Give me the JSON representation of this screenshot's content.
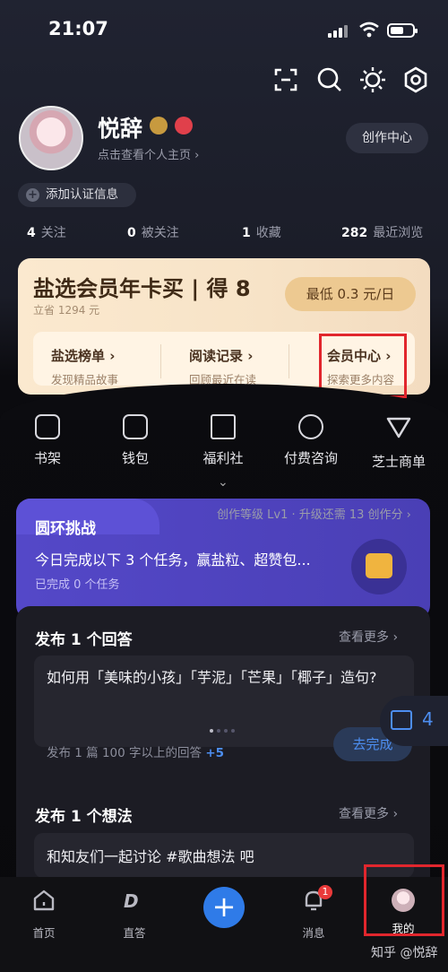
{
  "status": {
    "time": "21:07"
  },
  "profile": {
    "name": "悦辞",
    "subtitle": "点击查看个人主页 ›",
    "creator_button": "创作中心",
    "auth_button": "添加认证信息"
  },
  "stats": [
    {
      "value": "4",
      "label": "关注"
    },
    {
      "value": "0",
      "label": "被关注"
    },
    {
      "value": "1",
      "label": "收藏"
    },
    {
      "value": "282",
      "label": "最近浏览"
    }
  ],
  "vip": {
    "title": "盐选会员年卡买 | 得 8",
    "subtitle": "立省 1294 元",
    "price_button": "最低 0.3 元/日",
    "items": [
      {
        "title": "盐选榜单 ›",
        "desc": "发现精品故事"
      },
      {
        "title": "阅读记录 ›",
        "desc": "回顾最近在读"
      },
      {
        "title": "会员中心 ›",
        "desc": "探索更多内容"
      }
    ]
  },
  "quick": [
    {
      "label": "书架",
      "icon": "bookshelf-icon"
    },
    {
      "label": "钱包",
      "icon": "wallet-icon"
    },
    {
      "label": "福利社",
      "icon": "gift-icon"
    },
    {
      "label": "付费咨询",
      "icon": "yen-icon"
    },
    {
      "label": "芝士商单",
      "icon": "cheese-icon"
    }
  ],
  "level_text": "创作等级 Lv1 · 升级还需 13 创作分 ›",
  "challenge": {
    "title": "圆环挑战",
    "desc": "今日完成以下 3 个任务，赢盐粒、超赞包...",
    "done": "已完成 0 个任务"
  },
  "task1": {
    "title": "发布 1 个回答",
    "more": "查看更多 ›",
    "question": "如何用「美味的小孩」「芋泥」「芒果」「椰子」造句?",
    "hint": "发布 1 篇 100 字以上的回答",
    "reward": "+5",
    "go_button": "去完成"
  },
  "float_count": "4",
  "task2": {
    "title": "发布 1 个想法",
    "more": "查看更多 ›",
    "text": "和知友们一起讨论 #歌曲想法 吧"
  },
  "nav": [
    {
      "label": "首页"
    },
    {
      "label": "直答"
    },
    {
      "label": "消息",
      "badge": "1"
    },
    {
      "label": "我的"
    }
  ],
  "watermark": "知乎 @悦辞",
  "colors": {
    "accent": "#2f7be8",
    "vip_bg": "#fbe9cf",
    "challenge": "#5448c8",
    "highlight": "#e1262d"
  }
}
